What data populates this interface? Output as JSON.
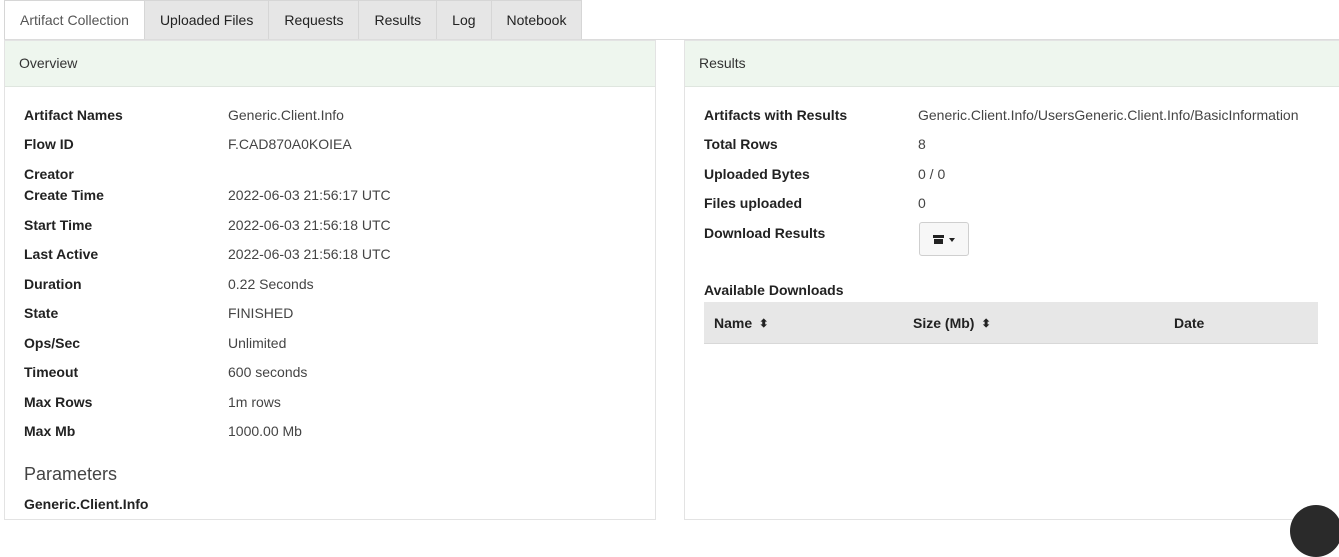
{
  "tabs": [
    {
      "label": "Artifact Collection",
      "active": true
    },
    {
      "label": "Uploaded Files"
    },
    {
      "label": "Requests"
    },
    {
      "label": "Results"
    },
    {
      "label": "Log"
    },
    {
      "label": "Notebook"
    }
  ],
  "overview": {
    "title": "Overview",
    "fields": [
      {
        "label": "Artifact Names",
        "value": "Generic.Client.Info"
      },
      {
        "label": "Flow ID",
        "value": "F.CAD870A0KOIEA"
      },
      {
        "label": "Creator",
        "value": ""
      },
      {
        "label": "Create Time",
        "value": "2022-06-03 21:56:17 UTC"
      },
      {
        "label": "Start Time",
        "value": "2022-06-03 21:56:18 UTC"
      },
      {
        "label": "Last Active",
        "value": "2022-06-03 21:56:18 UTC"
      },
      {
        "label": "Duration",
        "value": "0.22 Seconds"
      },
      {
        "label": "State",
        "value": "FINISHED"
      },
      {
        "label": "Ops/Sec",
        "value": "Unlimited"
      },
      {
        "label": "Timeout",
        "value": "600 seconds"
      },
      {
        "label": "Max Rows",
        "value": "1m rows"
      },
      {
        "label": "Max Mb",
        "value": "1000.00 Mb"
      }
    ],
    "parameters_title": "Parameters",
    "parameters_item": "Generic.Client.Info"
  },
  "results": {
    "title": "Results",
    "fields": [
      {
        "label": "Artifacts with Results",
        "value": "Generic.Client.Info/UsersGeneric.Client.Info/BasicInformation"
      },
      {
        "label": "Total Rows",
        "value": "8"
      },
      {
        "label": "Uploaded Bytes",
        "value": "0 / 0"
      },
      {
        "label": "Files uploaded",
        "value": "0"
      },
      {
        "label": "Download Results",
        "value": ""
      }
    ],
    "available_downloads_label": "Available Downloads",
    "downloads_columns": [
      {
        "label": "Name",
        "sortable": true
      },
      {
        "label": "Size (Mb)",
        "sortable": true
      },
      {
        "label": "Date",
        "sortable": false
      }
    ],
    "download_button_icon": "archive-icon"
  },
  "icons": {
    "sort": "sort-icon",
    "caret": "caret-down-icon"
  }
}
